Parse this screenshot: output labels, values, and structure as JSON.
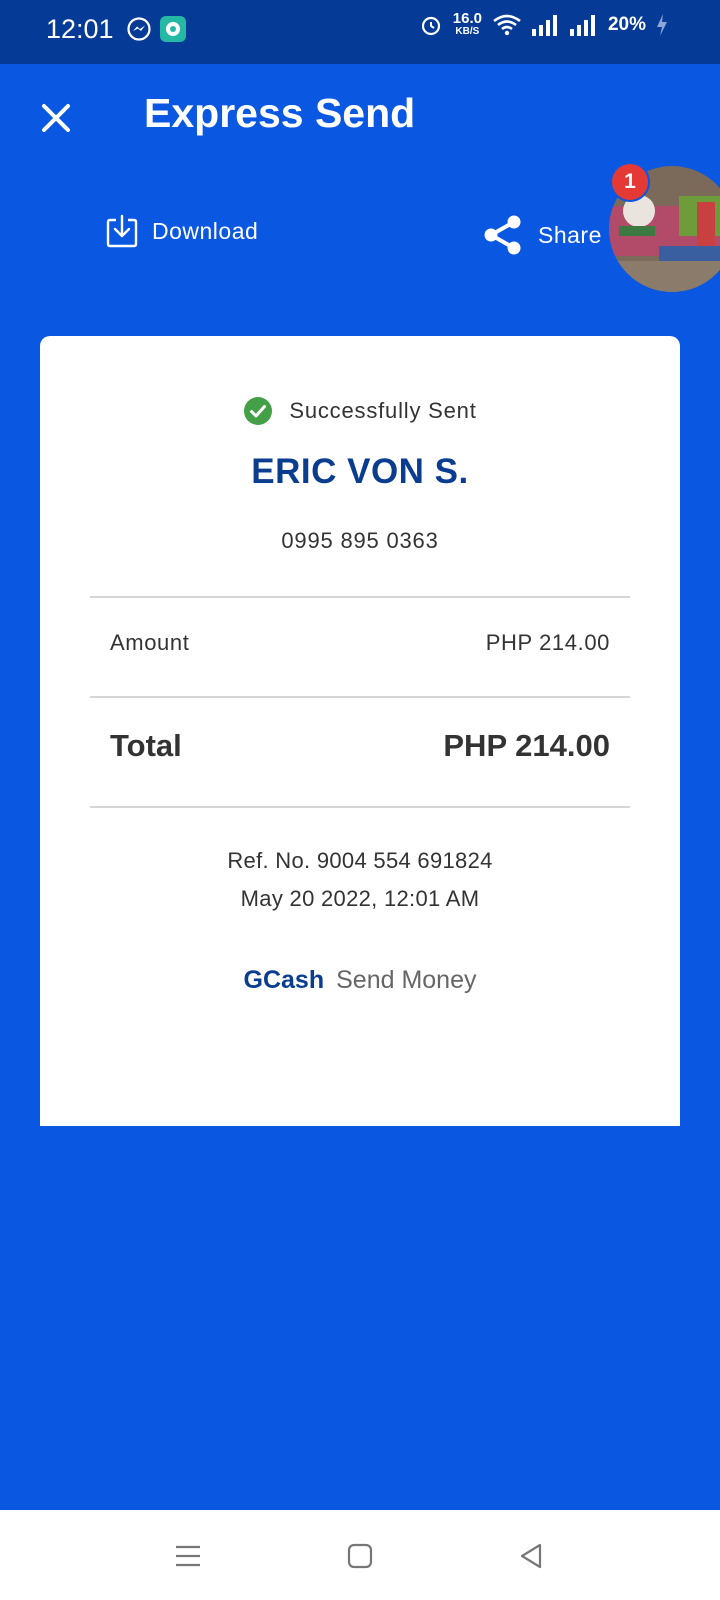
{
  "status_bar": {
    "time": "12:01",
    "net_speed_value": "16.0",
    "net_speed_unit": "KB/S",
    "battery": "20%",
    "icons": [
      "messenger-icon",
      "chat-app-icon",
      "alarm-icon",
      "wifi-icon",
      "signal-icon",
      "signal-icon",
      "charging-icon"
    ]
  },
  "header": {
    "title": "Express Send",
    "close_icon": "close-icon"
  },
  "actions": {
    "download_label": "Download",
    "share_label": "Share"
  },
  "chat_bubble": {
    "badge_count": "1"
  },
  "receipt": {
    "status": "Successfully Sent",
    "recipient_name": "ERIC VON S.",
    "recipient_phone": "0995 895 0363",
    "amount_label": "Amount",
    "amount_value": "PHP 214.00",
    "total_label": "Total",
    "total_value": "PHP 214.00",
    "reference": "Ref. No. 9004 554 691824",
    "datetime": "May 20 2022, 12:01 AM",
    "brand": "GCash",
    "brand_service": "Send Money"
  },
  "colors": {
    "background": "#0a57e1",
    "status_bar": "#053a96",
    "brand_blue": "#0a3d8f",
    "success_green": "#43a047",
    "badge_red": "#e53935"
  }
}
